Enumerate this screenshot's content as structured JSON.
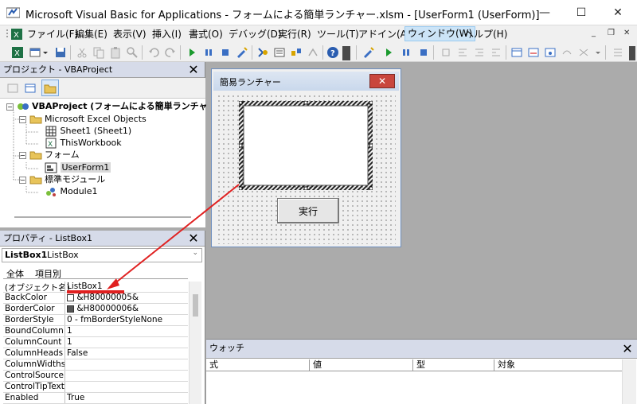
{
  "window": {
    "title": "Microsoft Visual Basic for Applications - フォームによる簡単ランチャー.xlsm - [UserForm1 (UserForm)]"
  },
  "menu": {
    "items": [
      "ファイル(F)",
      "編集(E)",
      "表示(V)",
      "挿入(I)",
      "書式(O)",
      "デバッグ(D)",
      "実行(R)",
      "ツール(T)",
      "アドイン(A)",
      "ウィンドウ(W)",
      "ヘルプ(H)"
    ],
    "selected": "ウィンドウ(W)"
  },
  "project_panel": {
    "title": "プロジェクト - VBAProject",
    "tree": {
      "root": "VBAProject (フォームによる簡単ランチャー.",
      "excel_objects": "Microsoft Excel Objects",
      "sheet1": "Sheet1 (Sheet1)",
      "thisworkbook": "ThisWorkbook",
      "forms": "フォーム",
      "userform1": "UserForm1",
      "modules": "標準モジュール",
      "module1": "Module1"
    }
  },
  "properties_panel": {
    "title": "プロパティ - ListBox1",
    "object_name": "ListBox1",
    "object_type": "ListBox",
    "tab_all": "全体",
    "tab_category": "項目別",
    "rows": [
      {
        "name": "(オブジェクト名)",
        "value": "ListBox1"
      },
      {
        "name": "BackColor",
        "value": "&H80000005&"
      },
      {
        "name": "BorderColor",
        "value": "&H80000006&"
      },
      {
        "name": "BorderStyle",
        "value": "0 - fmBorderStyleNone"
      },
      {
        "name": "BoundColumn",
        "value": "1"
      },
      {
        "name": "ColumnCount",
        "value": "1"
      },
      {
        "name": "ColumnHeads",
        "value": "False"
      },
      {
        "name": "ColumnWidths",
        "value": ""
      },
      {
        "name": "ControlSource",
        "value": ""
      },
      {
        "name": "ControlTipText",
        "value": ""
      },
      {
        "name": "Enabled",
        "value": "True"
      }
    ]
  },
  "userform": {
    "caption": "簡易ランチャー",
    "run_button_label": "実行"
  },
  "watch": {
    "title": "ウォッチ",
    "columns": [
      "式",
      "値",
      "型",
      "対象"
    ]
  },
  "colors": {
    "annotation_red": "#e02020",
    "panel_header": "#d6dbe9",
    "selected_menu": "#cce4f7"
  }
}
